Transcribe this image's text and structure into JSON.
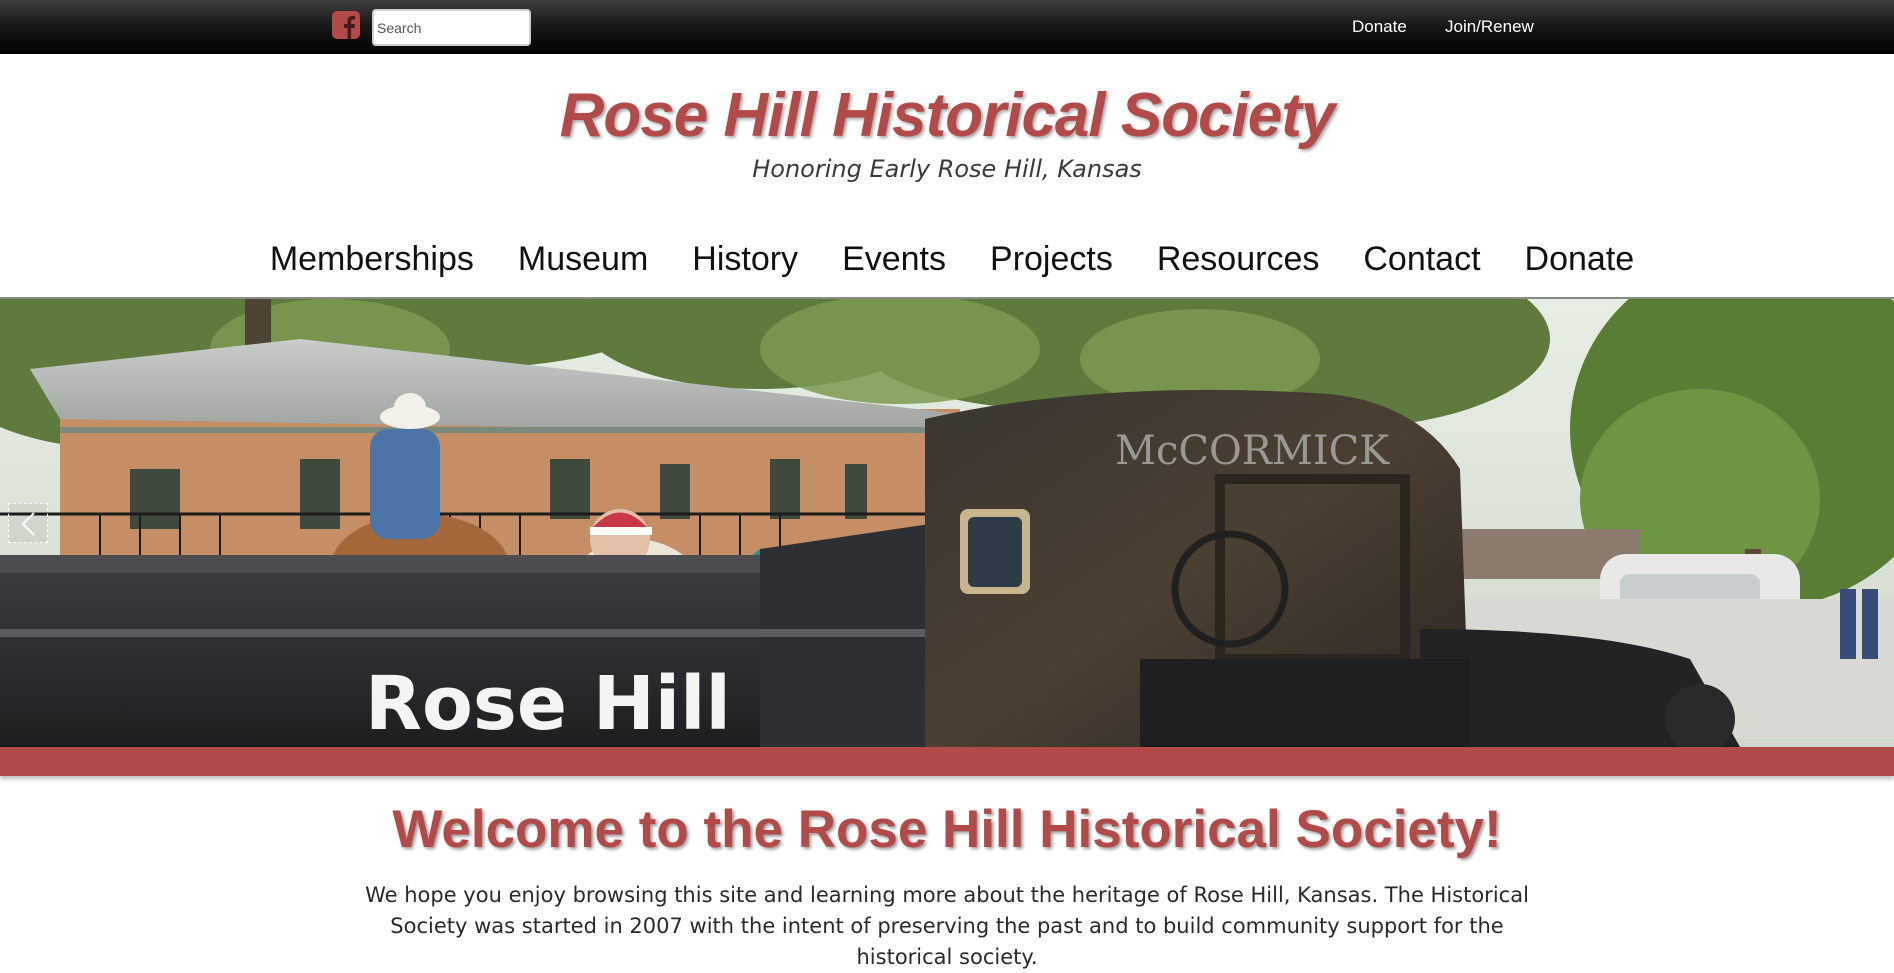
{
  "topbar": {
    "search_placeholder": "Search",
    "links": {
      "donate": "Donate",
      "join_renew": "Join/Renew"
    }
  },
  "header": {
    "title": "Rose Hill Historical Society",
    "subtitle": "Honoring Early Rose Hill, Kansas"
  },
  "nav": {
    "items": [
      "Memberships",
      "Museum",
      "History",
      "Events",
      "Projects",
      "Resources",
      "Contact",
      "Donate"
    ]
  },
  "hero": {
    "truck_side_text": "Rose Hill",
    "truck_cab_text": "McCORMICK"
  },
  "welcome": {
    "title": "Welcome to the Rose Hill Historical Society!",
    "body": "We hope you enjoy browsing this site and learning more about the heritage of Rose Hill, Kansas. The Historical Society was started in 2007 with the intent of preserving the past and to build community support for the historical society."
  },
  "colors": {
    "brand_red": "#b24a49",
    "topbar_black": "#000000",
    "nav_text": "#111111"
  },
  "icons": {
    "facebook": "facebook-icon",
    "slide_prev": "chevron-left-icon"
  }
}
